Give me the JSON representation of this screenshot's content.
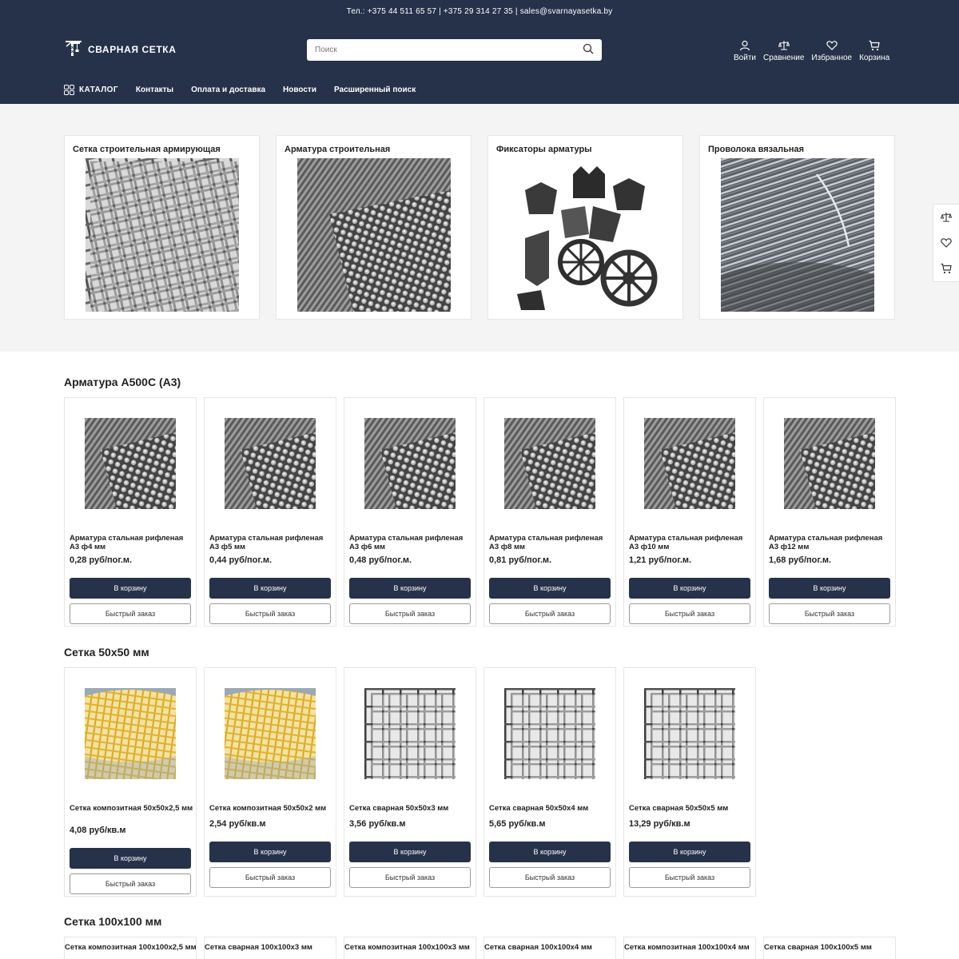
{
  "header": {
    "contacts_line": "Тел.: +375 44 511 65 57 | +375 29 314 27 35 | sales@svarnayasetka.by",
    "logo_text": "СВАРНАЯ СЕТКА",
    "search_placeholder": "Поиск",
    "icons": [
      {
        "label": "Войти",
        "icon": "user-icon"
      },
      {
        "label": "Сравнение",
        "icon": "scales-icon"
      },
      {
        "label": "Избранное",
        "icon": "heart-icon"
      },
      {
        "label": "Корзина",
        "icon": "cart-icon"
      }
    ],
    "nav": {
      "catalog": "КАТАЛОГ",
      "items": [
        "Контакты",
        "Оплата и доставка",
        "Новости",
        "Расширенный поиск"
      ]
    }
  },
  "categories": [
    {
      "title": "Сетка строительная армирующая",
      "image": "mesh-photo"
    },
    {
      "title": "Арматура строительная",
      "image": "rebar-photo"
    },
    {
      "title": "Фиксаторы арматуры",
      "image": "fixators-photo"
    },
    {
      "title": "Проволока вязальная",
      "image": "wire-coil-photo"
    }
  ],
  "sections": [
    {
      "title": "Арматура А500С (А3)",
      "products": [
        {
          "name": "Арматура стальная рифленая А3 ф4 мм",
          "price": "0,28 руб/пог.м.",
          "cart": "В корзину",
          "quick": "Быстрый заказ",
          "image": "rebar-photo"
        },
        {
          "name": "Арматура стальная рифленая А3 ф5 мм",
          "price": "0,44 руб/пог.м.",
          "cart": "В корзину",
          "quick": "Быстрый заказ",
          "image": "rebar-photo"
        },
        {
          "name": "Арматура стальная рифленая А3 ф6 мм",
          "price": "0,48 руб/пог.м.",
          "cart": "В корзину",
          "quick": "Быстрый заказ",
          "image": "rebar-photo"
        },
        {
          "name": "Арматура стальная рифленая А3 ф8 мм",
          "price": "0,81 руб/пог.м.",
          "cart": "В корзину",
          "quick": "Быстрый заказ",
          "image": "rebar-photo"
        },
        {
          "name": "Арматура стальная рифленая А3 ф10 мм",
          "price": "1,21 руб/пог.м.",
          "cart": "В корзину",
          "quick": "Быстрый заказ",
          "image": "rebar-photo"
        },
        {
          "name": "Арматура стальная рифленая А3 ф12 мм",
          "price": "1,68 руб/пог.м.",
          "cart": "В корзину",
          "quick": "Быстрый заказ",
          "image": "rebar-photo"
        }
      ]
    },
    {
      "title": "Сетка 50х50 мм",
      "products": [
        {
          "name": "Сетка композитная 50x50x2,5 мм",
          "price": "4,08 руб/кв.м",
          "cart": "В корзину",
          "quick": "Быстрый заказ",
          "image": "composite-mesh-photo"
        },
        {
          "name": "Сетка композитная 50x50x2 мм",
          "price": "2,54 руб/кв.м",
          "cart": "В корзину",
          "quick": "Быстрый заказ",
          "image": "composite-mesh-photo"
        },
        {
          "name": "Сетка сварная 50x50x3 мм",
          "price": "3,56 руб/кв.м",
          "cart": "В корзину",
          "quick": "Быстрый заказ",
          "image": "welded-mesh-photo"
        },
        {
          "name": "Сетка сварная 50x50x4 мм",
          "price": "5,65 руб/кв.м",
          "cart": "В корзину",
          "quick": "Быстрый заказ",
          "image": "welded-mesh-photo"
        },
        {
          "name": "Сетка сварная 50x50x5 мм",
          "price": "13,29 руб/кв.м",
          "cart": "В корзину",
          "quick": "Быстрый заказ",
          "image": "welded-mesh-photo"
        }
      ]
    },
    {
      "title": "Сетка 100х100 мм",
      "products": [
        {
          "name": "Сетка композитная 100x100x2,5 мм"
        },
        {
          "name": "Сетка сварная 100x100x3 мм"
        },
        {
          "name": "Сетка композитная 100x100x3 мм"
        },
        {
          "name": "Сетка сварная 100x100x4 мм"
        },
        {
          "name": "Сетка композитная 100x100x4 мм"
        },
        {
          "name": "Сетка сварная 100x100x5 мм"
        }
      ]
    }
  ],
  "colors": {
    "header_bg": "#26324a",
    "band_bg": "#f4f4f4",
    "button_primary": "#26324a",
    "composite_yellow": "#e2b93a"
  }
}
